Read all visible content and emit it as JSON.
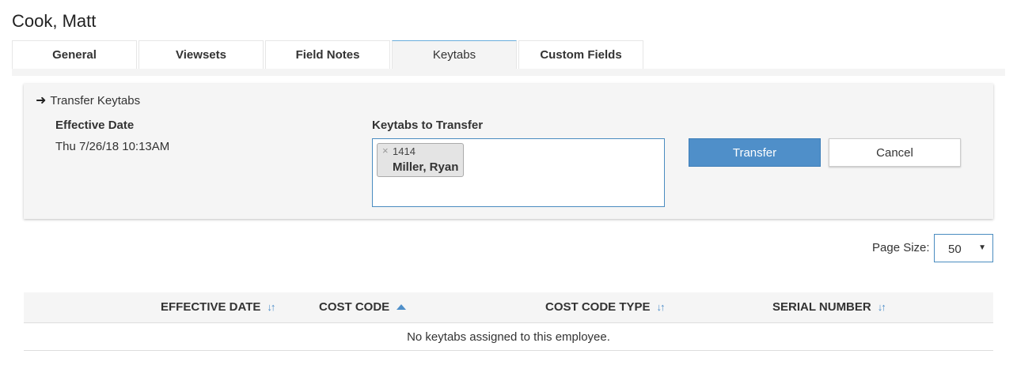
{
  "employee_name": "Cook, Matt",
  "tabs": [
    {
      "label": "General",
      "active": false
    },
    {
      "label": "Viewsets",
      "active": false
    },
    {
      "label": "Field Notes",
      "active": false
    },
    {
      "label": "Keytabs",
      "active": true
    },
    {
      "label": "Custom Fields",
      "active": false
    }
  ],
  "transfer_panel": {
    "heading_icon": "arrow-right-icon",
    "heading": "Transfer Keytabs",
    "effective_date_label": "Effective Date",
    "effective_date_value": "Thu 7/26/18 10:13AM",
    "keytabs_label": "Keytabs to Transfer",
    "selected_keytabs": [
      {
        "code": "1414",
        "name": "Miller, Ryan"
      }
    ],
    "transfer_button": "Transfer",
    "cancel_button": "Cancel"
  },
  "page_size": {
    "label": "Page Size:",
    "value": "50"
  },
  "table": {
    "columns": [
      {
        "label": "EFFECTIVE DATE",
        "sort": "sortable"
      },
      {
        "label": "COST CODE",
        "sort": "ascending"
      },
      {
        "label": "COST CODE TYPE",
        "sort": "sortable"
      },
      {
        "label": "SERIAL NUMBER",
        "sort": "sortable"
      }
    ],
    "empty_message": "No keytabs assigned to this employee."
  },
  "colors": {
    "primary": "#4f8fc9",
    "active_tab_border": "#6aaedc",
    "panel_bg": "#f5f5f5"
  }
}
